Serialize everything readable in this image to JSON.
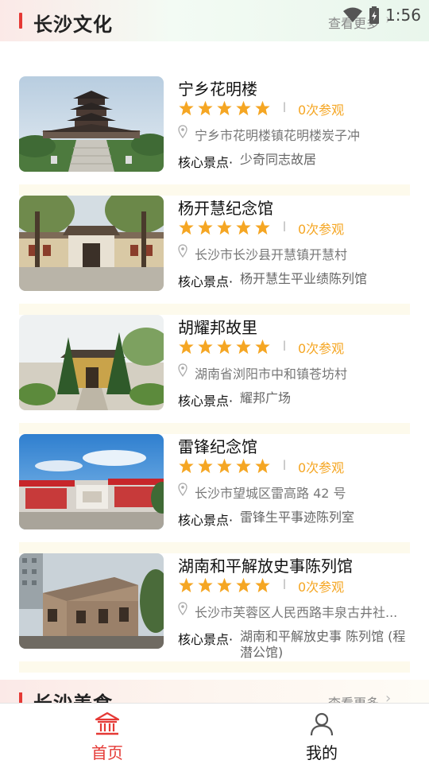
{
  "status_bar": {
    "time": "1:56"
  },
  "section_culture": {
    "title": "长沙文化",
    "more": "查看更多",
    "arrow": "›"
  },
  "cards": [
    {
      "title": "宁乡花明楼",
      "rating": 5,
      "divider": "|",
      "visits": "0次参观",
      "address": "宁乡市花明楼镇花明楼炭子冲",
      "core_label": "核心景点·",
      "core_value": "少奇同志故居"
    },
    {
      "title": "杨开慧纪念馆",
      "rating": 5,
      "divider": "|",
      "visits": "0次参观",
      "address": "长沙市长沙县开慧镇开慧村",
      "core_label": "核心景点·",
      "core_value": "杨开慧生平业绩陈列馆"
    },
    {
      "title": "胡耀邦故里",
      "rating": 5,
      "divider": "|",
      "visits": "0次参观",
      "address": "湖南省浏阳市中和镇苍坊村",
      "core_label": "核心景点·",
      "core_value": "耀邦广场"
    },
    {
      "title": "雷锋纪念馆",
      "rating": 5,
      "divider": "|",
      "visits": "0次参观",
      "address": "长沙市望城区雷高路 42 号",
      "core_label": "核心景点·",
      "core_value": "雷锋生平事迹陈列室"
    },
    {
      "title": "湖南和平解放史事陈列馆",
      "rating": 5,
      "divider": "|",
      "visits": "0次参观",
      "address": "长沙市芙蓉区人民西路丰泉古井社...",
      "core_label": "核心景点·",
      "core_value": "湖南和平解放史事 陈列馆 (程潜公馆)"
    }
  ],
  "section_food": {
    "title": "长沙美食",
    "more": "查看更多",
    "arrow": "›"
  },
  "bottom_nav": [
    {
      "label": "首页",
      "icon": "museum-icon",
      "active": true
    },
    {
      "label": "我的",
      "icon": "person-icon",
      "active": false
    }
  ],
  "colors": {
    "accent": "#e53935",
    "star": "#f5a623",
    "visits": "#f5a623"
  }
}
